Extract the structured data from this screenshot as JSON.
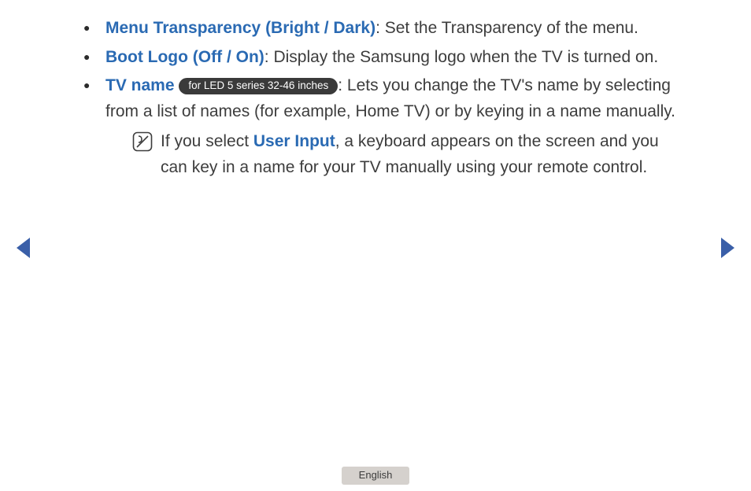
{
  "items": [
    {
      "title": "Menu Transparency (Bright / Dark)",
      "desc": ": Set the Transparency of the menu."
    },
    {
      "title": "Boot Logo (Off / On)",
      "desc": ": Display the Samsung logo when the TV is turned on."
    },
    {
      "title": "TV name",
      "badge": "for LED 5 series 32-46 inches",
      "desc": ": Lets you change the TV's name by selecting from a list of names (for example, Home TV) or by keying in a name manually.",
      "note": {
        "pre": "If you select ",
        "link": "User Input",
        "post": ", a keyboard appears on the screen and you can key in a name for your TV manually using your remote control."
      }
    }
  ],
  "footer": {
    "language": "English"
  }
}
